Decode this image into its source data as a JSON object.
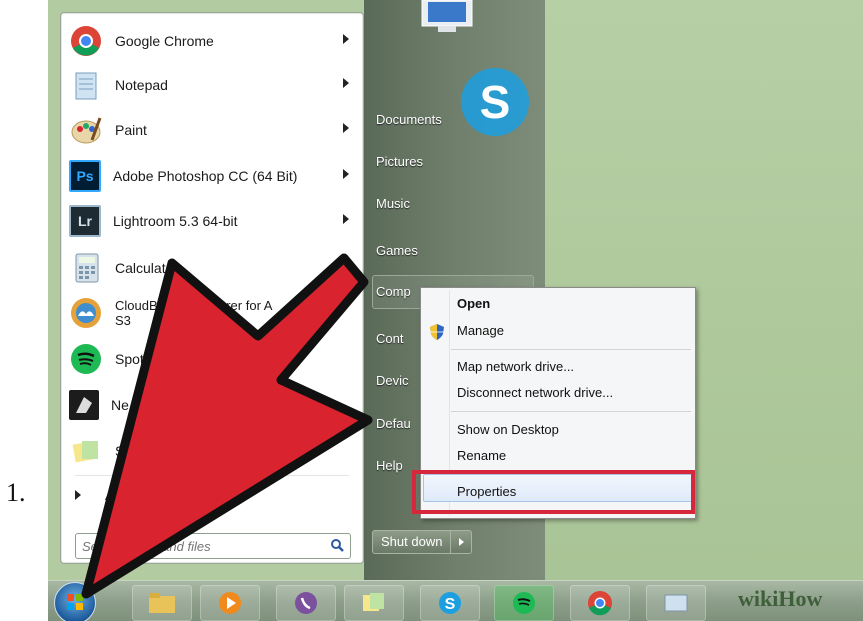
{
  "step_number": "1.",
  "start_menu": {
    "programs": [
      {
        "label": "Google Chrome",
        "icon": "chrome-icon",
        "has_submenu": true
      },
      {
        "label": "Notepad",
        "icon": "notepad-icon",
        "has_submenu": true
      },
      {
        "label": "Paint",
        "icon": "paint-icon",
        "has_submenu": true
      },
      {
        "label": "Adobe Photoshop CC (64 Bit)",
        "icon": "photoshop-icon",
        "has_submenu": true
      },
      {
        "label": "Lightroom 5.3 64-bit",
        "icon": "lightroom-icon",
        "has_submenu": true
      },
      {
        "label": "Calculator",
        "icon": "calculator-icon",
        "has_submenu": false
      },
      {
        "label": "CloudBe",
        "label_tail": "olorer for A",
        "label_line2": "S3",
        "icon": "cloudberry-icon",
        "has_submenu": false
      },
      {
        "label": "Spotif",
        "icon": "spotify-icon",
        "has_submenu": false
      },
      {
        "label": "Ne",
        "icon": "nero-icon",
        "has_submenu": false
      },
      {
        "label": "St",
        "icon": "sticky-notes-icon",
        "has_submenu": false
      }
    ],
    "all_programs": "A",
    "search_placeholder": "Se          ams and files",
    "right_pane": {
      "documents": "Documents",
      "pictures": "Pictures",
      "music": "Music",
      "games": "Games",
      "computer": "Comp",
      "control_panel": "Cont",
      "devices": "Devic",
      "default_programs": "Defau",
      "help": "Help",
      "skype_label": "Skype"
    },
    "shutdown_label": "Shut down"
  },
  "context_menu": {
    "open": "Open",
    "manage": "Manage",
    "map_drive": "Map network drive...",
    "disconnect_drive": "Disconnect network drive...",
    "show_desktop": "Show on Desktop",
    "rename": "Rename",
    "properties": "Properties"
  },
  "watermark": {
    "wiki": "wiki",
    "how": "How"
  },
  "colors": {
    "highlight_frame": "#d6273c",
    "arrow": "#d9232e",
    "desktop": "#b3cba0"
  }
}
